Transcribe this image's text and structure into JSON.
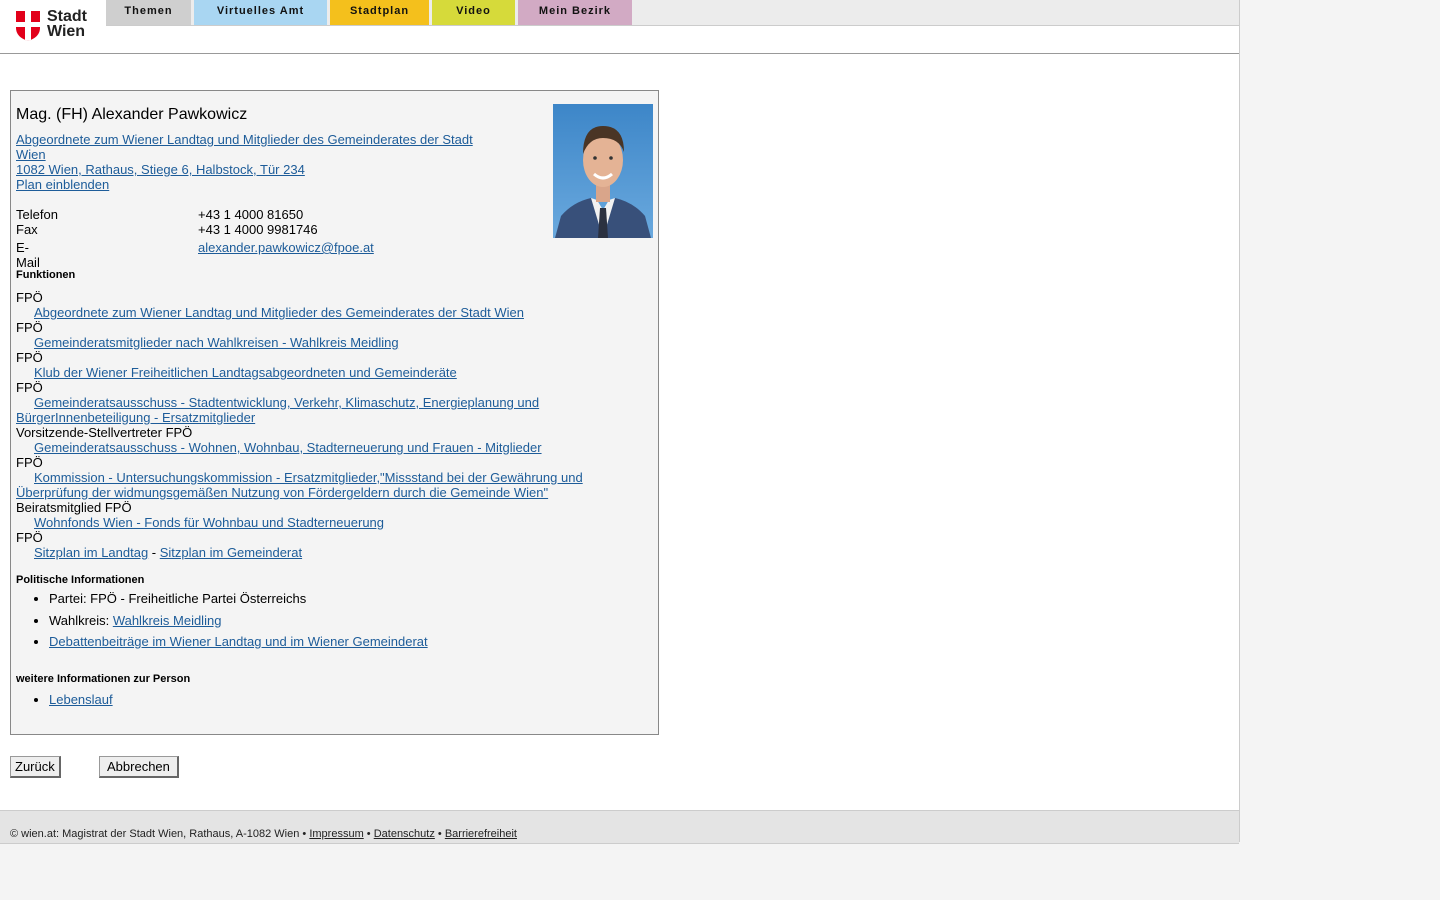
{
  "logo": {
    "line1": "Stadt",
    "line2": "Wien"
  },
  "nav": {
    "tabs": [
      {
        "label": "Themen",
        "color": "#cfcfcf"
      },
      {
        "label": "Virtuelles Amt",
        "color": "#a9d6f2"
      },
      {
        "label": "Stadtplan",
        "color": "#f4c01c"
      },
      {
        "label": "Video",
        "color": "#d6da3a"
      },
      {
        "label": "Mein Bezirk",
        "color": "#d2aac4"
      }
    ]
  },
  "person": {
    "name": "Mag. (FH) Alexander Pawkowicz",
    "role_line1": "Abgeordnete zum Wiener Landtag und Mitglieder des Gemeinderates der Stadt",
    "role_line2": "Wien ",
    "address": "1082 Wien, Rathaus, Stiege 6, Halbstock, Tür 234",
    "plan_link": "Plan einblenden"
  },
  "contact": {
    "phone_label": "Telefon",
    "phone": "+43 1 4000 81650",
    "fax_label": "Fax",
    "fax": "+43 1 4000 9981746",
    "email_label": "E-Mail",
    "email": "alexander.pawkowicz@fpoe.at"
  },
  "functions": {
    "heading": "Funktionen",
    "items": [
      {
        "org": "FPÖ",
        "link": "Abgeordnete zum Wiener Landtag und Mitglieder des Gemeinderates der Stadt Wien"
      },
      {
        "org": "FPÖ",
        "link": "Gemeinderatsmitglieder nach Wahlkreisen - Wahlkreis Meidling"
      },
      {
        "org": "FPÖ",
        "link": "Klub der Wiener Freiheitlichen Landtagsabgeordneten und Gemeinderäte"
      },
      {
        "org": "FPÖ",
        "link": "Gemeinderatsausschuss - Stadtentwicklung, Verkehr, Klimaschutz, Energieplanung und BürgerInnenbeteiligung - Ersatzmitglieder"
      },
      {
        "org": "Vorsitzende-Stellvertreter FPÖ",
        "link": "Gemeinderatsausschuss - Wohnen, Wohnbau, Stadterneuerung und Frauen - Mitglieder"
      },
      {
        "org": "FPÖ",
        "link": "Kommission - Untersuchungskommission - Ersatzmitglieder,\"Missstand bei der Gewährung und Überprüfung der widmungsgemäßen Nutzung von Fördergeldern durch die Gemeinde Wien\""
      },
      {
        "org": "Beiratsmitglied FPÖ",
        "link": "Wohnfonds Wien - Fonds für Wohnbau und Stadterneuerung"
      }
    ],
    "last_org": "FPÖ",
    "seat_landtag": "Sitzplan im Landtag",
    "seat_sep": " - ",
    "seat_gemeinderat": "Sitzplan im Gemeinderat"
  },
  "politics": {
    "heading": "Politische Informationen",
    "party": "Partei: FPÖ - Freiheitliche Partei Österreichs",
    "district_label": "Wahlkreis: ",
    "district_link": "Wahlkreis Meidling",
    "debates_link": "Debattenbeiträge im Wiener Landtag und im Wiener Gemeinderat"
  },
  "more": {
    "heading": "weitere Informationen zur Person",
    "cv_link": "Lebenslauf"
  },
  "buttons": {
    "back": "Zurück",
    "cancel": "Abbrechen"
  },
  "footer": {
    "text": "© wien.at: Magistrat der Stadt Wien, Rathaus, A-1082 Wien • ",
    "impressum": "Impressum",
    "sep1": " • ",
    "datenschutz": "Datenschutz",
    "sep2": " • ",
    "barrierefreiheit": "Barrierefreiheit"
  }
}
